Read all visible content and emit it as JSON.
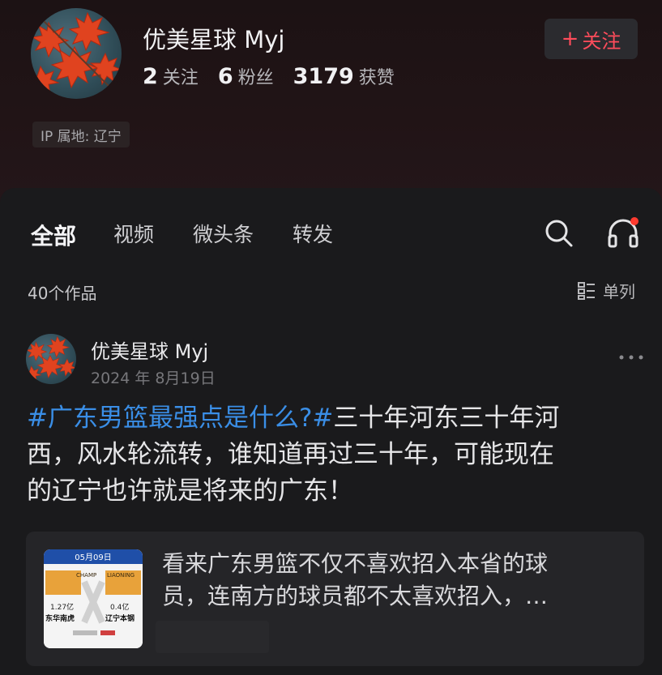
{
  "profile": {
    "name": "优美星球 Myj",
    "stats": [
      {
        "num": "2",
        "label": "关注"
      },
      {
        "num": "6",
        "label": "粉丝"
      },
      {
        "num": "3179",
        "label": "获赞"
      }
    ],
    "follow_plus": "+",
    "follow_label": "关注",
    "ip_location": "IP 属地: 辽宁"
  },
  "tabs": [
    {
      "label": "全部",
      "active": true
    },
    {
      "label": "视频",
      "active": false
    },
    {
      "label": "微头条",
      "active": false
    },
    {
      "label": "转发",
      "active": false
    }
  ],
  "content": {
    "count_label": "40个作品",
    "view_mode_label": "单列"
  },
  "post": {
    "author": "优美星球 Myj",
    "date": "2024 年 8月19日",
    "hashtag": "#广东男篮最强点是什么?#",
    "text_line1": "三十年河东三十年河",
    "text_line2": "西，风水轮流转，谁知道再过三十年，可能现在",
    "text_line3": "的辽宁也许就是将来的广东！",
    "quote": {
      "line1": "看来广东男篮不仅不喜欢招入本省的球",
      "line2": "员，连南方的球员都不太喜欢招入，…",
      "thumb_header": "05月09日",
      "thumb_left_value": "1.27亿",
      "thumb_left_team": "东华南虎",
      "thumb_right_value": "0.4亿",
      "thumb_right_team": "辽宁本钢"
    }
  },
  "colors": {
    "accent_red": "#ff4c5b",
    "hashtag_blue": "#3a8ee6",
    "notification_dot": "#ff3b30"
  },
  "icons": [
    "search-icon",
    "headset-icon",
    "list-view-icon",
    "more-icon",
    "maple-leaf-avatar"
  ]
}
